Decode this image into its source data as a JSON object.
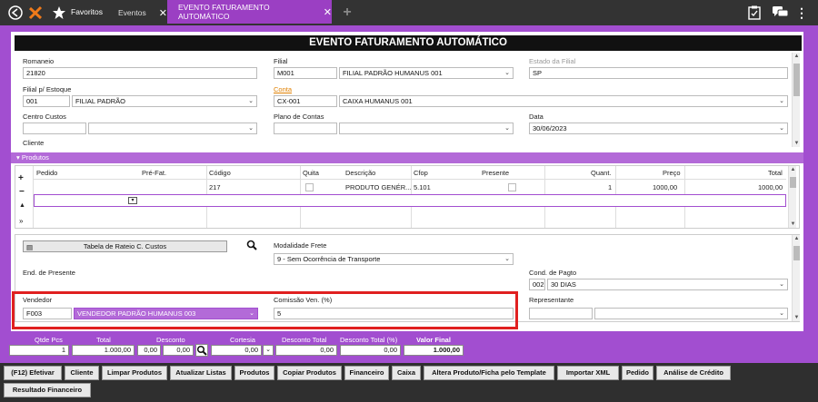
{
  "topbar": {
    "favorites_label": "Favoritos",
    "tab_eventos": "Eventos",
    "tab_active": "EVENTO FATURAMENTO AUTOMÁTICO"
  },
  "form": {
    "title": "EVENTO FATURAMENTO AUTOMÁTICO",
    "romaneio": {
      "label": "Romaneio",
      "value": "21820"
    },
    "filial": {
      "label": "Filial",
      "code": "M001",
      "name": "FILIAL PADRÃO HUMANUS 001"
    },
    "estado_filial": {
      "label": "Estado da Filial",
      "value": "SP"
    },
    "filial_estoque": {
      "label": "Filial p/ Estoque",
      "code": "001",
      "name": "FILIAL PADRÃO"
    },
    "conta": {
      "label": "Conta",
      "code": "CX-001",
      "name": "CAIXA HUMANUS 001"
    },
    "centro_custos": {
      "label": "Centro Custos"
    },
    "plano_contas": {
      "label": "Plano de Contas"
    },
    "data": {
      "label": "Data",
      "value": "30/06/2023"
    },
    "cliente": {
      "label": "Cliente"
    }
  },
  "produtos": {
    "header": "Produtos",
    "columns": [
      "Pedido",
      "Pré-Fat.",
      "Código",
      "Quita",
      "Descrição",
      "Cfop",
      "Presente",
      "Quant.",
      "Preço",
      "Total"
    ],
    "row": {
      "codigo": "217",
      "descricao": "PRODUTO GENÉR...",
      "cfop": "5.101",
      "quant": "1",
      "preco": "1000,00",
      "total": "1000,00"
    }
  },
  "lower": {
    "rateio_button": "Tabela de Rateio C. Custos",
    "modalidade_frete": {
      "label": "Modalidade Frete",
      "value": "9 - Sem Ocorrência de Transporte"
    },
    "end_presente": {
      "label": "End. de Presente"
    },
    "cond_pagto": {
      "label": "Cond. de Pagto",
      "code": "002",
      "name": "30 DIAS"
    },
    "vendedor": {
      "label": "Vendedor",
      "code": "F003",
      "name": "VENDEDOR PADRÃO HUMANUS 003"
    },
    "comissao": {
      "label": "Comissão Ven. (%)",
      "value": "5"
    },
    "representante": {
      "label": "Representante"
    }
  },
  "totals": {
    "qtde_pcs": {
      "label": "Qtde Pcs",
      "value": "1"
    },
    "total": {
      "label": "Total",
      "value": "1.000,00"
    },
    "desconto": {
      "label": "Desconto",
      "v1": "0,00",
      "v2": "0,00"
    },
    "cortesia": {
      "label": "Cortesia",
      "value": "0,00"
    },
    "desconto_total": {
      "label": "Desconto Total",
      "value": "0,00"
    },
    "desconto_total_pct": {
      "label": "Desconto Total (%)",
      "value": "0,00"
    },
    "valor_final": {
      "label": "Valor Final",
      "value": "1.000,00"
    }
  },
  "buttons": [
    "(F12) Efetivar",
    "Cliente",
    "Limpar Produtos",
    "Atualizar Listas",
    "Produtos",
    "Copiar Produtos",
    "Financeiro",
    "Caixa",
    "Altera Produto/Ficha pelo Template",
    "Importar XML",
    "Pedido",
    "Análise de Crédito",
    "Resultado Financeiro"
  ],
  "colors": {
    "accent": "#a24ed0",
    "highlight": "#e02020"
  }
}
